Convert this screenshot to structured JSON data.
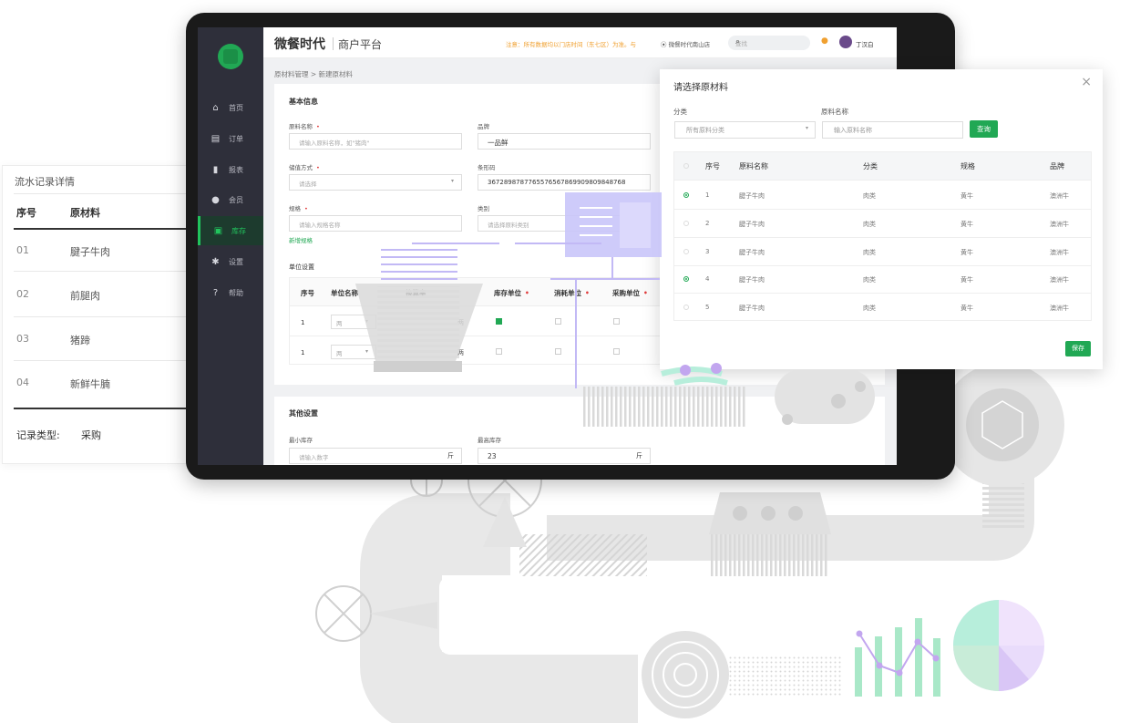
{
  "left_card": {
    "title": "流水记录详情",
    "col_no": "序号",
    "col_material": "原材料",
    "rows": [
      {
        "no": "01",
        "name": "腱子牛肉"
      },
      {
        "no": "02",
        "name": "前腿肉"
      },
      {
        "no": "03",
        "name": "猪蹄"
      },
      {
        "no": "04",
        "name": "新鲜牛腩"
      }
    ],
    "record_type_label": "记录类型:",
    "record_type_value": "采购"
  },
  "app": {
    "brand": "微餐时代",
    "brand_sub": "商户平台",
    "notice": "注意：所有数据均以门店时间（东七区）为准。与",
    "location": "微餐时代南山店",
    "search_placeholder": "查找",
    "user": "丁汉白",
    "nav": [
      {
        "label": "首页",
        "icon": "home-icon"
      },
      {
        "label": "订单",
        "icon": "order-icon"
      },
      {
        "label": "报表",
        "icon": "chart-icon"
      },
      {
        "label": "会员",
        "icon": "people-icon"
      },
      {
        "label": "库存",
        "icon": "inventory-icon",
        "active": true
      },
      {
        "label": "设置",
        "icon": "gear-icon"
      },
      {
        "label": "帮助",
        "icon": "help-icon"
      }
    ],
    "breadcrumb": "原材料管理 > 新建原材料",
    "basic": {
      "title": "基本信息",
      "name_label": "原料名称",
      "name_placeholder": "请输入原料名称，如\"猪肉\"",
      "brand_label": "品牌",
      "brand_value": "一品鲜",
      "storage_label": "储值方式",
      "storage_placeholder": "请选择",
      "barcode_label": "条形码",
      "barcode_value": "3672898787765576567869909809848768",
      "spec_label": "规格",
      "spec_placeholder": "请输入规格名称",
      "category_label": "类别",
      "category_placeholder": "请选择原料类别",
      "add_spec": "新增规格"
    },
    "units": {
      "title": "单位设置",
      "headers": [
        "序号",
        "单位名称",
        "换算率",
        "库存单位",
        "消耗单位",
        "采购单位"
      ],
      "rows": [
        {
          "no": "1",
          "unit": "两",
          "conv": "两"
        },
        {
          "no": "1",
          "unit": "两",
          "conv": "两"
        }
      ]
    },
    "other": {
      "title": "其他设置",
      "min_label": "最小库存",
      "min_placeholder": "请输入数字",
      "min_unit": "斤",
      "max_label": "最高库存",
      "max_value": "23",
      "max_unit": "斤"
    }
  },
  "modal": {
    "title": "请选择原材料",
    "category_label": "分类",
    "category_value": "所有原料分类",
    "name_label": "原料名称",
    "name_placeholder": "输入原料名称",
    "query": "查询",
    "headers": [
      "序号",
      "原料名称",
      "分类",
      "规格",
      "品牌"
    ],
    "rows": [
      {
        "no": "1",
        "name": "腱子牛肉",
        "cat": "肉类",
        "spec": "黄牛",
        "brand": "澳洲牛",
        "selected": true
      },
      {
        "no": "2",
        "name": "腱子牛肉",
        "cat": "肉类",
        "spec": "黄牛",
        "brand": "澳洲牛",
        "selected": false
      },
      {
        "no": "3",
        "name": "腱子牛肉",
        "cat": "肉类",
        "spec": "黄牛",
        "brand": "澳洲牛",
        "selected": false
      },
      {
        "no": "4",
        "name": "腱子牛肉",
        "cat": "肉类",
        "spec": "黄牛",
        "brand": "澳洲牛",
        "selected": true
      },
      {
        "no": "5",
        "name": "腱子牛肉",
        "cat": "肉类",
        "spec": "黄牛",
        "brand": "澳洲牛",
        "selected": false
      }
    ],
    "save": "保存"
  },
  "colors": {
    "accent": "#21a854",
    "sidebar": "#2e2f3a",
    "warning": "#f0a030",
    "required": "#e03b3b"
  }
}
